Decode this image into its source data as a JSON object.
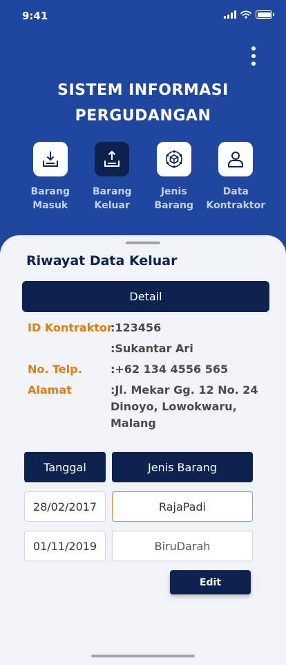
{
  "status": {
    "time": "9:41"
  },
  "app": {
    "title_line1": "SISTEM INFORMASI",
    "title_line2": "PERGUDANGAN"
  },
  "nav": [
    {
      "label": "Barang\nMasuk",
      "icon": "download-box-icon",
      "active": false
    },
    {
      "label": "Barang\nKeluar",
      "icon": "upload-box-icon",
      "active": true
    },
    {
      "label": "Jenis\nBarang",
      "icon": "cube-network-icon",
      "active": false
    },
    {
      "label": "Data\nKontraktor",
      "icon": "user-icon",
      "active": false
    }
  ],
  "section": {
    "title": "Riwayat Data Keluar",
    "detail_label": "Detail"
  },
  "detail": {
    "id_label": "ID Kontraktor",
    "id_value": ":123456",
    "name_value": ":Sukantar Ari",
    "phone_label": "No. Telp.",
    "phone_value": ":+62 134 4556 565",
    "address_label": "Alamat",
    "address_value": ":Jl. Mekar Gg. 12 No. 24 Dinoyo, Lowokwaru, Malang"
  },
  "table": {
    "headers": {
      "date": "Tanggal",
      "type": "Jenis Barang"
    },
    "rows": [
      {
        "date": "28/02/2017",
        "type": "RajaPadi"
      },
      {
        "date": "01/11/2019",
        "type": "BiruDarah"
      }
    ]
  },
  "actions": {
    "edit_label": "Edit"
  },
  "colors": {
    "brand_blue": "#1f47a0",
    "navy": "#0e2250",
    "accent_orange": "#e07e12"
  }
}
